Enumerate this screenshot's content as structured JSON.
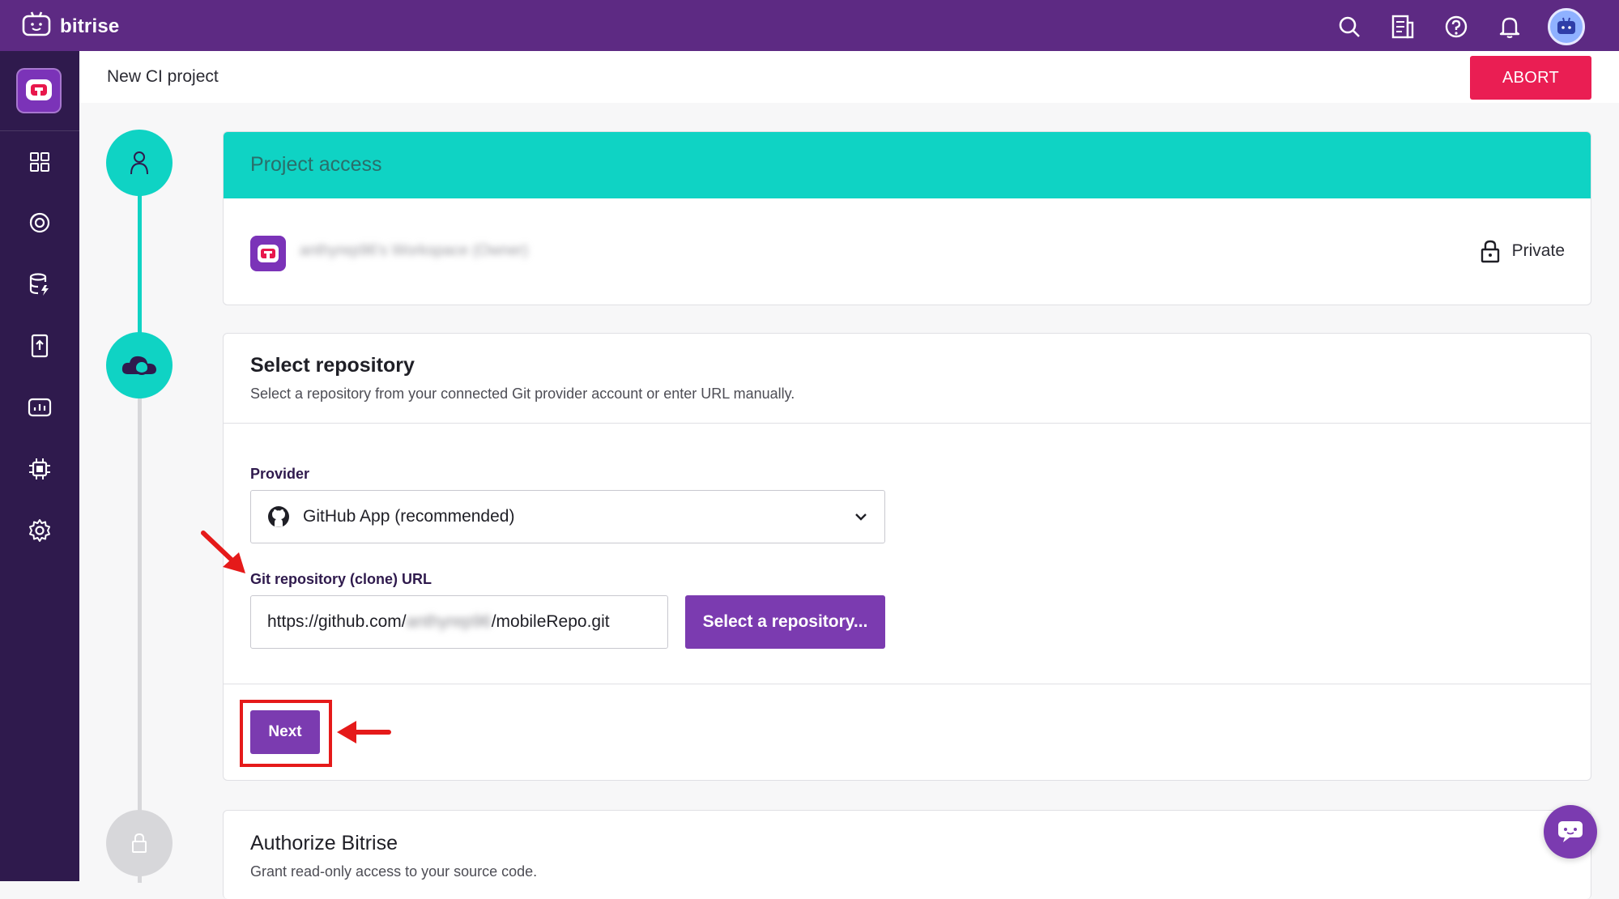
{
  "app": {
    "brand": "bitrise"
  },
  "colors": {
    "topbar": "#5d2a83",
    "sidebar": "#2f1a4d",
    "accent": "#7b3bb0",
    "teal": "#0fd3c4",
    "abort": "#ea1e53",
    "annotation": "#e51a1a"
  },
  "topbar": {
    "icons": [
      "search-icon",
      "changelog-icon",
      "help-icon",
      "bell-icon",
      "avatar"
    ]
  },
  "sidebar": {
    "items": [
      "dashboard-icon",
      "builds-icon",
      "cache-icon",
      "release-icon",
      "insights-icon",
      "build-infra-icon",
      "settings-icon"
    ]
  },
  "subheader": {
    "title": "New CI project",
    "abort_label": "ABORT"
  },
  "project_access": {
    "title": "Project access",
    "workspace_name": "anthyrep96's Workspace (Owner)",
    "visibility": "Private"
  },
  "select_repository": {
    "title": "Select repository",
    "subtitle": "Select a repository from your connected Git provider account or enter URL manually.",
    "provider_label": "Provider",
    "provider_value": "GitHub App (recommended)",
    "url_label": "Git repository (clone) URL",
    "url_prefix": "https://github.com/",
    "url_user": "anthyrep96",
    "url_suffix": "/mobileRepo.git",
    "select_button": "Select a repository...",
    "next_button": "Next"
  },
  "authorize": {
    "title": "Authorize Bitrise",
    "subtitle": "Grant read-only access to your source code."
  }
}
